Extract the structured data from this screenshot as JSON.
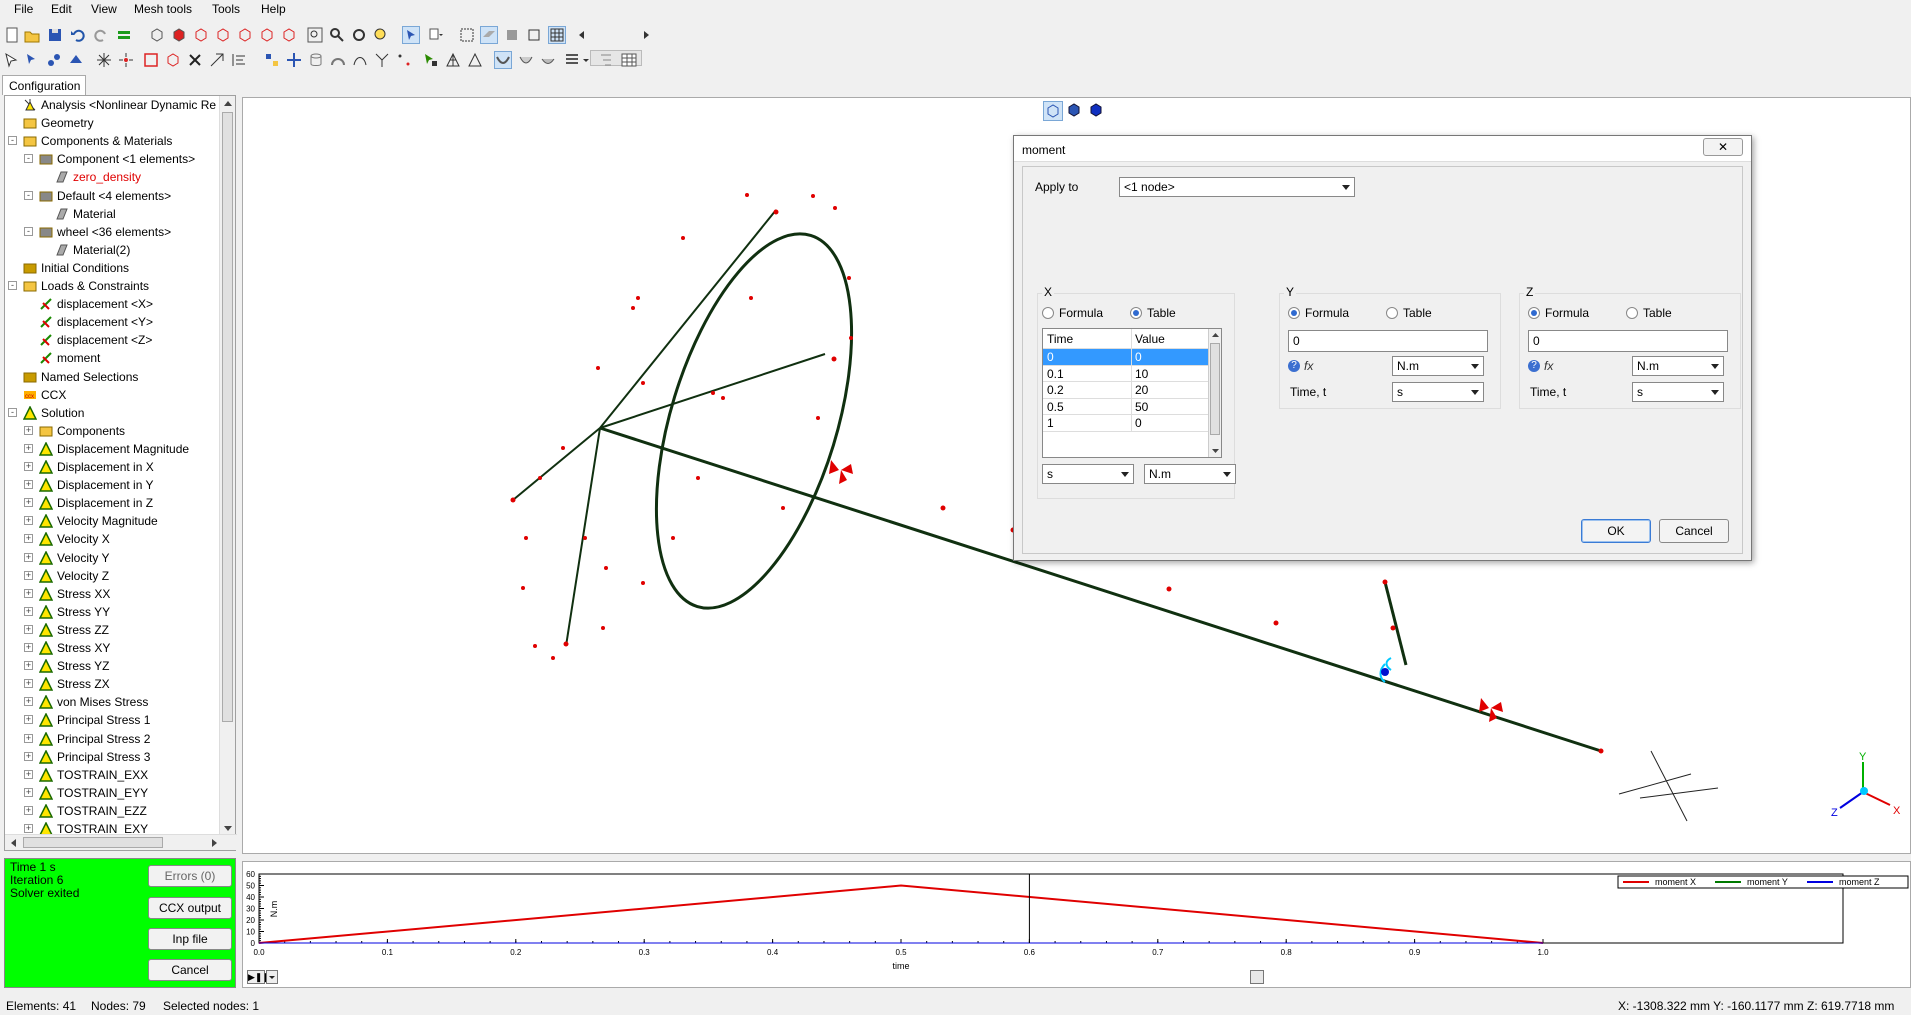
{
  "menubar": [
    "File",
    "Edit",
    "View",
    "Mesh tools",
    "Tools",
    "Help"
  ],
  "config_tab": "Configuration",
  "tree": [
    {
      "label": "Analysis <Nonlinear Dynamic Re",
      "level": 0,
      "icon": "analysis-icon",
      "color": "#000000"
    },
    {
      "label": "Geometry",
      "level": 0,
      "icon": "folder-icon",
      "color": "#000000"
    },
    {
      "label": "Components & Materials",
      "level": 0,
      "icon": "components-icon",
      "color": "#000000",
      "exp": "-"
    },
    {
      "label": "Component <1 elements>",
      "level": 1,
      "icon": "component-icon",
      "color": "#000000",
      "exp": "-"
    },
    {
      "label": "zero_density",
      "level": 2,
      "icon": "material-icon",
      "color": "#e00000"
    },
    {
      "label": "Default <4 elements>",
      "level": 1,
      "icon": "component-icon",
      "color": "#000000",
      "exp": "-"
    },
    {
      "label": "Material",
      "level": 2,
      "icon": "material-icon",
      "color": "#000000"
    },
    {
      "label": "wheel <36 elements>",
      "level": 1,
      "icon": "component-icon",
      "color": "#000000",
      "exp": "-"
    },
    {
      "label": "Material(2)",
      "level": 2,
      "icon": "material-icon",
      "color": "#000000"
    },
    {
      "label": "Initial Conditions",
      "level": 0,
      "icon": "initial-conditions-icon",
      "color": "#000000"
    },
    {
      "label": "Loads & Constraints",
      "level": 0,
      "icon": "loads-icon",
      "color": "#000000",
      "exp": "-"
    },
    {
      "label": "displacement <X>",
      "level": 1,
      "icon": "displacement-icon",
      "color": "#000000"
    },
    {
      "label": "displacement <Y>",
      "level": 1,
      "icon": "displacement-icon",
      "color": "#000000"
    },
    {
      "label": "displacement <Z>",
      "level": 1,
      "icon": "displacement-icon",
      "color": "#000000"
    },
    {
      "label": "moment",
      "level": 1,
      "icon": "moment-icon",
      "color": "#000000"
    },
    {
      "label": "Named Selections",
      "level": 0,
      "icon": "named-selection-icon",
      "color": "#000000"
    },
    {
      "label": "CCX",
      "level": 0,
      "icon": "ccx-icon",
      "color": "#000000"
    },
    {
      "label": "Solution",
      "level": 0,
      "icon": "solution-icon",
      "color": "#000000",
      "exp": "-"
    },
    {
      "label": "Components",
      "level": 1,
      "icon": "components-icon",
      "color": "#000000",
      "exp": "+"
    },
    {
      "label": "Displacement Magnitude",
      "level": 1,
      "icon": "result-icon",
      "color": "#000000",
      "exp": "+"
    },
    {
      "label": "Displacement in X",
      "level": 1,
      "icon": "result-icon",
      "color": "#000000",
      "exp": "+"
    },
    {
      "label": "Displacement in Y",
      "level": 1,
      "icon": "result-icon",
      "color": "#000000",
      "exp": "+"
    },
    {
      "label": "Displacement in Z",
      "level": 1,
      "icon": "result-icon",
      "color": "#000000",
      "exp": "+"
    },
    {
      "label": "Velocity Magnitude",
      "level": 1,
      "icon": "result-icon",
      "color": "#000000",
      "exp": "+"
    },
    {
      "label": "Velocity X",
      "level": 1,
      "icon": "result-icon",
      "color": "#000000",
      "exp": "+"
    },
    {
      "label": "Velocity Y",
      "level": 1,
      "icon": "result-icon",
      "color": "#000000",
      "exp": "+"
    },
    {
      "label": "Velocity Z",
      "level": 1,
      "icon": "result-icon",
      "color": "#000000",
      "exp": "+"
    },
    {
      "label": "Stress XX",
      "level": 1,
      "icon": "result-icon",
      "color": "#000000",
      "exp": "+"
    },
    {
      "label": "Stress YY",
      "level": 1,
      "icon": "result-icon",
      "color": "#000000",
      "exp": "+"
    },
    {
      "label": "Stress ZZ",
      "level": 1,
      "icon": "result-icon",
      "color": "#000000",
      "exp": "+"
    },
    {
      "label": "Stress XY",
      "level": 1,
      "icon": "result-icon",
      "color": "#000000",
      "exp": "+"
    },
    {
      "label": "Stress YZ",
      "level": 1,
      "icon": "result-icon",
      "color": "#000000",
      "exp": "+"
    },
    {
      "label": "Stress ZX",
      "level": 1,
      "icon": "result-icon",
      "color": "#000000",
      "exp": "+"
    },
    {
      "label": "von Mises Stress",
      "level": 1,
      "icon": "result-icon",
      "color": "#000000",
      "exp": "+"
    },
    {
      "label": "Principal Stress 1",
      "level": 1,
      "icon": "result-icon",
      "color": "#000000",
      "exp": "+"
    },
    {
      "label": "Principal Stress 2",
      "level": 1,
      "icon": "result-icon",
      "color": "#000000",
      "exp": "+"
    },
    {
      "label": "Principal Stress 3",
      "level": 1,
      "icon": "result-icon",
      "color": "#000000",
      "exp": "+"
    },
    {
      "label": "TOSTRAIN_EXX",
      "level": 1,
      "icon": "result-icon",
      "color": "#000000",
      "exp": "+"
    },
    {
      "label": "TOSTRAIN_EYY",
      "level": 1,
      "icon": "result-icon",
      "color": "#000000",
      "exp": "+"
    },
    {
      "label": "TOSTRAIN_EZZ",
      "level": 1,
      "icon": "result-icon",
      "color": "#000000",
      "exp": "+"
    },
    {
      "label": "TOSTRAIN_EXY",
      "level": 1,
      "icon": "result-icon",
      "color": "#000000",
      "exp": "+"
    }
  ],
  "status_panel": {
    "lines": [
      "Time 1 s",
      "Iteration 6",
      "Solver exited"
    ],
    "errors_button": "Errors (0)",
    "ccx_output_button": "CCX output",
    "inp_file_button": "Inp file",
    "cancel_button": "Cancel",
    "background": "#00ff00"
  },
  "dialog": {
    "title": "moment",
    "close_glyph": "✕",
    "apply_to_label": "Apply to",
    "apply_to_value": "<1 node>",
    "x": {
      "label": "X",
      "formula_label": "Formula",
      "table_label": "Table",
      "mode": "table",
      "columns": [
        "Time",
        "Value"
      ],
      "rows": [
        [
          "0",
          "0"
        ],
        [
          "0.1",
          "10"
        ],
        [
          "0.2",
          "20"
        ],
        [
          "0.5",
          "50"
        ],
        [
          "1",
          "0"
        ]
      ],
      "selected_row": 0,
      "time_unit": "s",
      "value_unit": "N.m"
    },
    "y": {
      "label": "Y",
      "formula_label": "Formula",
      "table_label": "Table",
      "mode": "formula",
      "value": "0",
      "fx_label": "fx",
      "unit": "N.m",
      "time_label": "Time, t",
      "time_unit": "s"
    },
    "z": {
      "label": "Z",
      "formula_label": "Formula",
      "table_label": "Table",
      "mode": "formula",
      "value": "0",
      "fx_label": "fx",
      "unit": "N.m",
      "time_label": "Time, t",
      "time_unit": "s"
    },
    "ok_button": "OK",
    "cancel_button": "Cancel"
  },
  "plot": {
    "ylabel": "N.m",
    "xlabel": "time",
    "y_ticks": [
      "60",
      "50",
      "40",
      "30",
      "20",
      "10",
      "0"
    ],
    "x_ticks": [
      "0.0",
      "0.1",
      "0.2",
      "0.3",
      "0.4",
      "0.5",
      "0.6",
      "0.7",
      "0.8",
      "0.9",
      "1.0"
    ],
    "legend": [
      {
        "name": "moment X",
        "color": "#e00000"
      },
      {
        "name": "moment Y",
        "color": "#007a00"
      },
      {
        "name": "moment Z",
        "color": "#0000e0"
      }
    ],
    "current_time": 0.6
  },
  "chart_data": {
    "type": "line",
    "xlabel": "time",
    "ylabel": "N.m",
    "xlim": [
      0,
      1
    ],
    "ylim": [
      0,
      60
    ],
    "series": [
      {
        "name": "moment X",
        "x": [
          0,
          0.5,
          1
        ],
        "y": [
          0,
          50,
          0
        ],
        "color": "#e00000"
      },
      {
        "name": "moment Y",
        "x": [
          0,
          1
        ],
        "y": [
          0,
          0
        ],
        "color": "#007a00"
      },
      {
        "name": "moment Z",
        "x": [
          0,
          1
        ],
        "y": [
          0,
          0
        ],
        "color": "#0000e0"
      }
    ],
    "legend": "top-right"
  },
  "statusbar": {
    "elements": "Elements: 41",
    "nodes": "Nodes: 79",
    "selected": "Selected nodes: 1",
    "coords": "X: -1308.322 mm Y: -160.1177 mm Z: 619.7718 mm"
  }
}
